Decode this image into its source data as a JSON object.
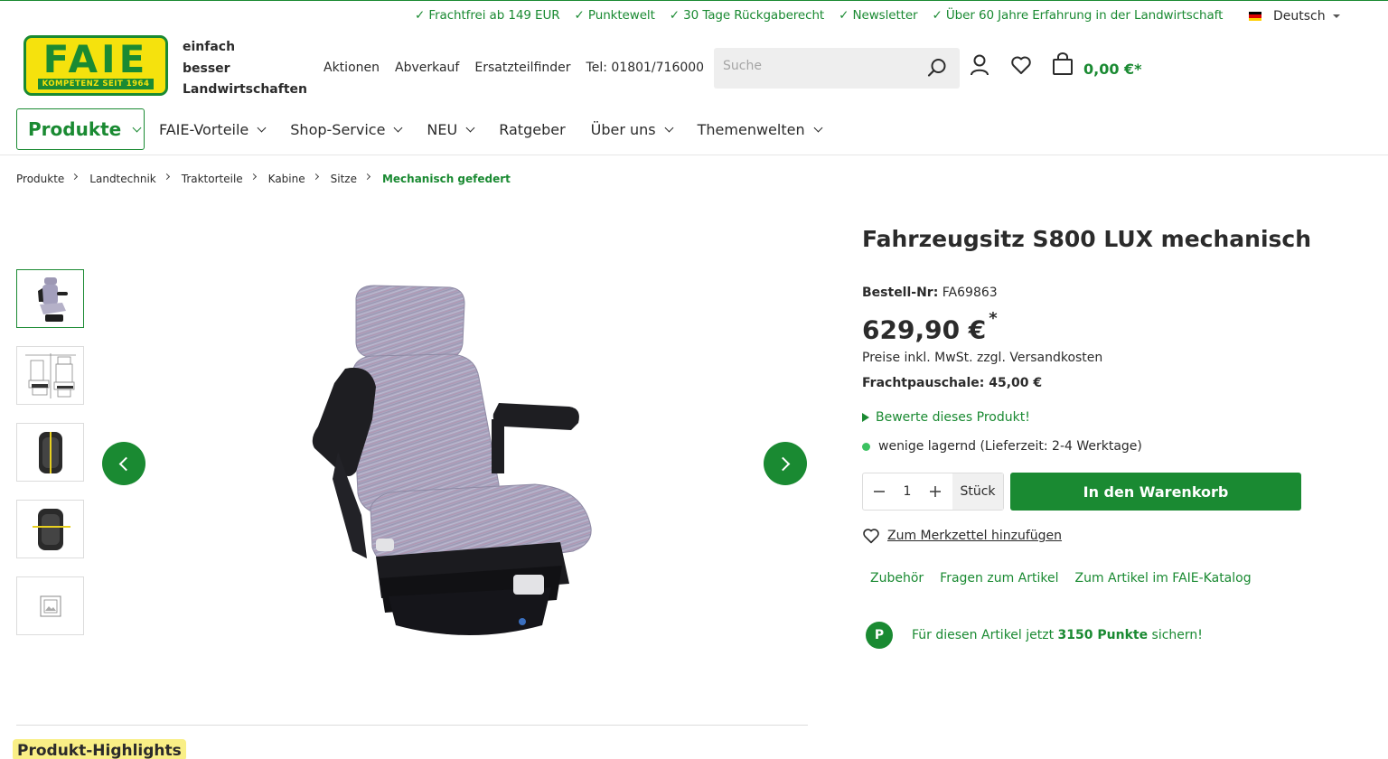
{
  "usps": [
    "✓ Frachtfrei ab 149 EUR",
    "✓ Punktewelt",
    "✓ 30 Tage Rückgaberecht",
    "✓ Newsletter",
    "✓ Über 60 Jahre Erfahrung in der Landwirtschaft"
  ],
  "language": "Deutsch",
  "logo": {
    "main": "FAIE",
    "sub": "KOMPETENZ SEIT 1964"
  },
  "slogan": [
    "einfach",
    "besser",
    "Landwirtschaften"
  ],
  "service_links": [
    "Aktionen",
    "Abverkauf",
    "Ersatzteilfinder",
    "Tel: 01801/716000"
  ],
  "search": {
    "placeholder": "Suche"
  },
  "cart_total": "0,00 €*",
  "nav": {
    "products": "Produkte",
    "items": [
      "FAIE-Vorteile",
      "Shop-Service",
      "NEU",
      "Ratgeber",
      "Über uns",
      "Themenwelten"
    ]
  },
  "breadcrumb": [
    "Produkte",
    "Landtechnik",
    "Traktorteile",
    "Kabine",
    "Sitze",
    "Mechanisch gefedert"
  ],
  "product": {
    "title": "Fahrzeugsitz S800 LUX mechanisch",
    "order_label": "Bestell-Nr:",
    "order_no": "FA69863",
    "price": "629,90 €",
    "price_star": "*",
    "vat_note": "Preise inkl. MwSt. zzgl. Versandkosten",
    "freight": "Frachtpauschale: 45,00 €",
    "rate": "Bewerte dieses Produkt!",
    "stock": "wenige lagernd (Lieferzeit: 2-4 Werktage)",
    "qty": "1",
    "unit": "Stück",
    "add_to_cart": "In den Warenkorb",
    "wishlist": "Zum Merkzettel hinzufügen",
    "tabs": [
      "Zubehör",
      "Fragen zum Artikel",
      "Zum Artikel im FAIE-Katalog"
    ],
    "points_pre": "Für diesen Artikel jetzt",
    "points_value": "3150 Punkte",
    "points_post": "sichern!",
    "points_badge": "P"
  },
  "highlights_title": "Produkt-Highlights",
  "colors": {
    "brand_green": "#1a8a32",
    "brand_yellow": "#f5e20d",
    "stock_green": "#3cc261"
  }
}
